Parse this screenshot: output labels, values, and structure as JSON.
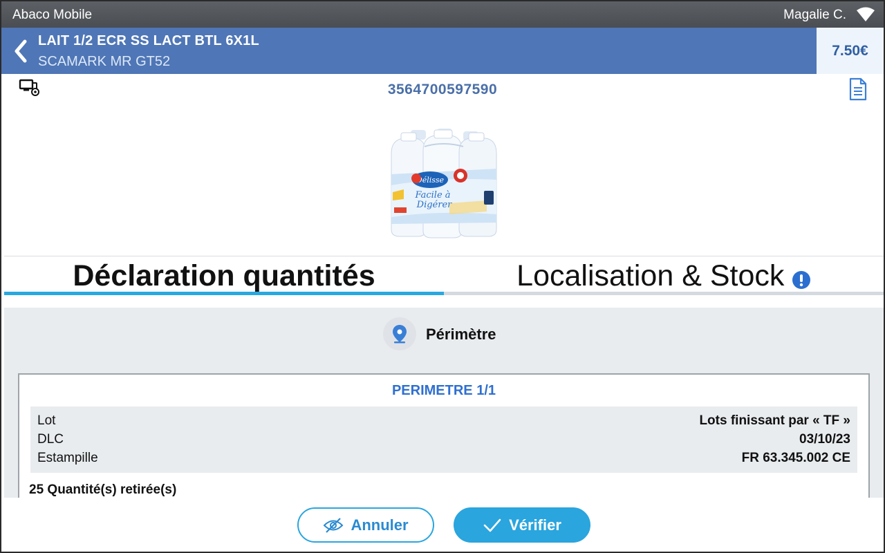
{
  "statusbar": {
    "app_name": "Abaco Mobile",
    "user_name": "Magalie C.",
    "wifi_icon": "wifi-icon"
  },
  "header": {
    "back_icon": "chevron-left-icon",
    "title": "LAIT 1/2 ECR SS LACT BTL 6X1L",
    "subtitle": "SCAMARK MR GT52",
    "price": "7.50€"
  },
  "product": {
    "barcode": "3564700597590",
    "device_icon": "device-eye-icon",
    "doc_icon": "document-icon",
    "image_alt": "product-image"
  },
  "tabs": [
    {
      "label": "Déclaration quantités",
      "active": true
    },
    {
      "label": "Localisation & Stock",
      "active": false,
      "icon": "alert-icon"
    }
  ],
  "perimeter": {
    "section_title": "Périmètre",
    "section_icon": "location-pin-icon",
    "card_title": "PERIMETRE 1/1",
    "rows": [
      {
        "label": "Lot",
        "value": "Lots finissant par « TF »"
      },
      {
        "label": "DLC",
        "value": "03/10/23"
      },
      {
        "label": "Estampille",
        "value": "FR 63.345.002 CE"
      }
    ],
    "quantity_text": "25 Quantité(s) retirée(s)"
  },
  "footer": {
    "cancel_label": "Annuler",
    "cancel_icon": "eye-slash-icon",
    "verify_label": "Vérifier",
    "verify_icon": "check-icon"
  },
  "colors": {
    "header_bg": "#4f76b6",
    "accent": "#2aa5de",
    "barcode": "#4a6fa8",
    "perimeter_title": "#2f6fd0"
  }
}
